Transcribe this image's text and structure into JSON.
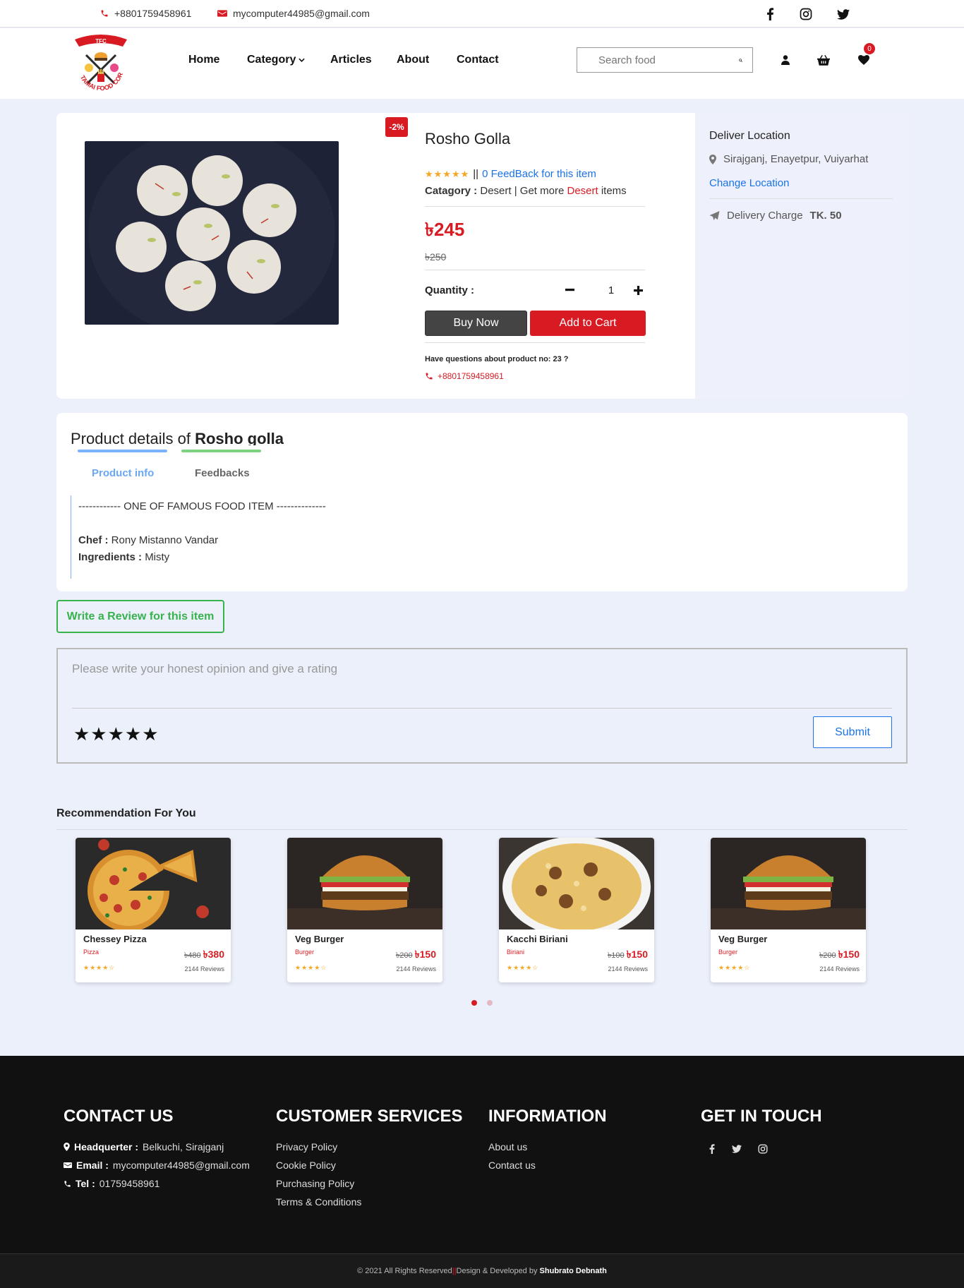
{
  "topbar": {
    "phone": "+8801759458961",
    "email": "mycomputer44985@gmail.com"
  },
  "logo": {
    "badge": "TFC",
    "text": "TAMAI FOOD CORNER"
  },
  "nav": {
    "home": "Home",
    "category": "Category",
    "articles": "Articles",
    "about": "About",
    "contact": "Contact",
    "search_placeholder": "Search food",
    "cart_count": "0"
  },
  "product": {
    "discount": "-2%",
    "name": "Rosho Golla",
    "stars": "★★★★★",
    "feedback_sep": "||",
    "feedback_link": "0 FeedBack for this item",
    "category_label": "Catagory :",
    "category_value": "Desert",
    "category_more_prefix": "| Get more",
    "category_more_link": "Desert",
    "category_more_suffix": "items",
    "price": "৳245",
    "old_price": "৳250",
    "quantity_label": "Quantity :",
    "quantity_value": "1",
    "buy_now": "Buy Now",
    "add_to_cart": "Add to Cart",
    "question": "Have questions about product no: 23 ?",
    "question_phone": "+8801759458961"
  },
  "delivery": {
    "title": "Deliver Location",
    "location": "Sirajganj, Enayetpur, Vuiyarhat",
    "change": "Change Location",
    "charge_label": "Delivery Charge",
    "charge_value": "TK. 50"
  },
  "details": {
    "title_prefix": "Product details of",
    "title_name": "Rosho golla",
    "tab_info": "Product info",
    "tab_feedbacks": "Feedbacks",
    "headline": "------------ ONE OF FAMOUS FOOD ITEM --------------",
    "chef_label": "Chef :",
    "chef_value": "Rony Mistanno Vandar",
    "ingredients_label": "Ingredients :",
    "ingredients_value": "Misty"
  },
  "review": {
    "button": "Write a Review for this item",
    "placeholder": "Please write your honest opinion and give a rating",
    "stars": "★★★★★",
    "submit": "Submit"
  },
  "recommendation": {
    "title": "Recommendation For You",
    "items": [
      {
        "name": "Chessey Pizza",
        "category": "Pizza",
        "old_price": "৳480",
        "price": "৳380",
        "stars": "★★★★☆",
        "reviews": "2144 Reviews"
      },
      {
        "name": "Veg Burger",
        "category": "Burger",
        "old_price": "৳200",
        "price": "৳150",
        "stars": "★★★★☆",
        "reviews": "2144 Reviews"
      },
      {
        "name": "Kacchi Biriani",
        "category": "Biriani",
        "old_price": "৳100",
        "price": "৳150",
        "stars": "★★★★☆",
        "reviews": "2144 Reviews"
      },
      {
        "name": "Veg Burger",
        "category": "Burger",
        "old_price": "৳200",
        "price": "৳150",
        "stars": "★★★★☆",
        "reviews": "2144 Reviews"
      }
    ]
  },
  "footer": {
    "contact_title": "CONTACT US",
    "hq_label": "Headquerter :",
    "hq_value": "Belkuchi, Sirajganj",
    "email_label": "Email :",
    "email_value": "mycomputer44985@gmail.com",
    "tel_label": "Tel :",
    "tel_value": "01759458961",
    "services_title": "CUSTOMER SERVICES",
    "services": [
      "Privacy Policy",
      "Cookie Policy",
      "Purchasing Policy",
      "Terms & Conditions"
    ],
    "info_title": "INFORMATION",
    "info": [
      "About us",
      "Contact us"
    ],
    "touch_title": "GET IN TOUCH",
    "copyright": "© 2021 All Rights Reserved",
    "sep": "||",
    "design": "Design & Developed by",
    "author": "Shubrato Debnath"
  },
  "colors": {
    "accent": "#d81b23",
    "link": "#1a73e8",
    "green": "#37b24d",
    "page_bg": "#ecf0fb"
  }
}
